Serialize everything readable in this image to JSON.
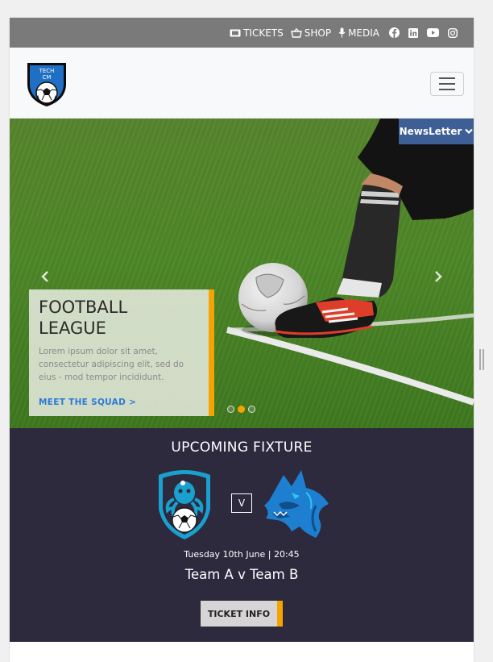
{
  "topbar": {
    "links": [
      {
        "label": "TICKETS",
        "icon": "ticket-icon"
      },
      {
        "label": "SHOP",
        "icon": "basket-icon"
      },
      {
        "label": "MEDIA",
        "icon": "microphone-icon"
      }
    ],
    "social": [
      "facebook-icon",
      "linkedin-icon",
      "youtube-icon",
      "instagram-icon"
    ]
  },
  "logo": {
    "line1": "TECH",
    "line2": "CM"
  },
  "newsletter": {
    "label": "NewsLetter"
  },
  "hero": {
    "title": "FOOTBALL LEAGUE",
    "body": "Lorem ipsum dolor sit amet, consectetur adipiscing elit, sed do eius - mod tempor incididunt.",
    "cta": "MEET THE SQUAD >",
    "slides": 3,
    "active_slide": 2
  },
  "fixture": {
    "heading": "UPCOMING FIXTURE",
    "vs": "V",
    "date": "Tuesday 10th June | 20:45",
    "teams": "Team A v Team B",
    "button": "TICKET INFO"
  },
  "colors": {
    "accent": "#f5a300",
    "newsletter_bg": "#3d5f96",
    "fixture_bg": "#2d2a3e",
    "link_blue": "#2b7bd6"
  }
}
